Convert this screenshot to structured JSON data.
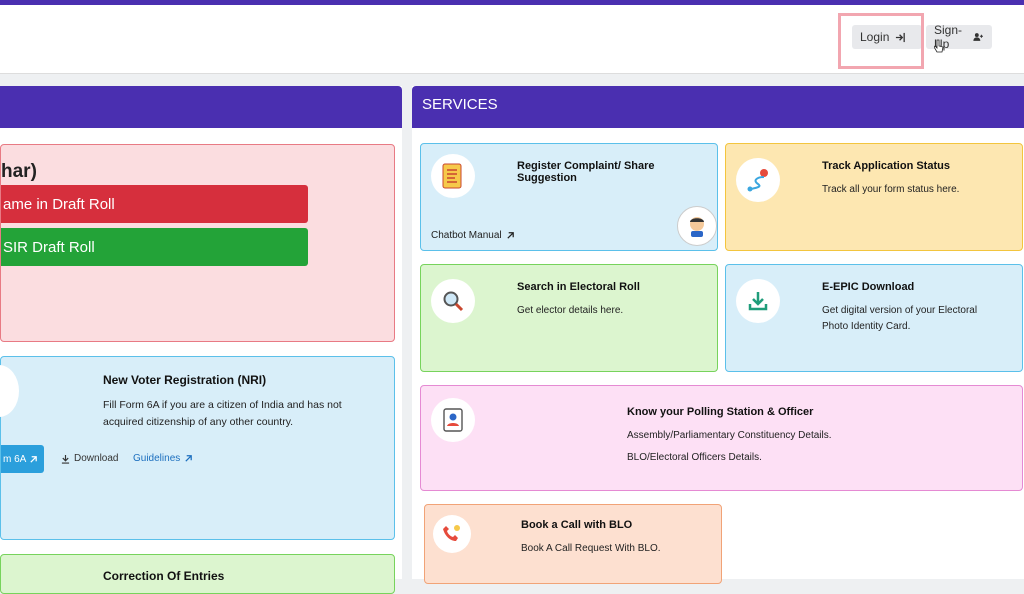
{
  "header": {
    "login_label": "Login",
    "signup_label": "Sign-Up"
  },
  "left": {
    "heading_partial": "har)",
    "btn_draft_roll": "ame in Draft Roll",
    "btn_sir_roll": "SIR Draft Roll",
    "nri": {
      "title": "New Voter Registration (NRI)",
      "desc": "Fill Form 6A if you are a citizen of India and has not acquired citizenship of any other country.",
      "form_btn": "m 6A",
      "download": "Download",
      "guidelines": "Guidelines"
    },
    "correction_title": "Correction Of Entries"
  },
  "services": {
    "title": "SERVICES",
    "items": [
      {
        "title": "Register Complaint/ Share Suggestion",
        "link": "Chatbot Manual"
      },
      {
        "title": "Track Application Status",
        "desc": "Track all your form status here."
      },
      {
        "title": "Search in Electoral Roll",
        "desc": "Get elector details here."
      },
      {
        "title": "E-EPIC Download",
        "desc": "Get digital version of your Electoral Photo Identity Card."
      },
      {
        "title": "Know your Polling Station & Officer",
        "desc1": "Assembly/Parliamentary Constituency Details.",
        "desc2": "BLO/Electoral Officers Details."
      },
      {
        "title": "Book a Call with BLO",
        "desc": "Book A Call Request With BLO."
      }
    ]
  },
  "colors": {
    "brand": "#4a2fb0",
    "red": "#d62f3d",
    "green": "#23a338",
    "info": "#2b9fdc"
  }
}
